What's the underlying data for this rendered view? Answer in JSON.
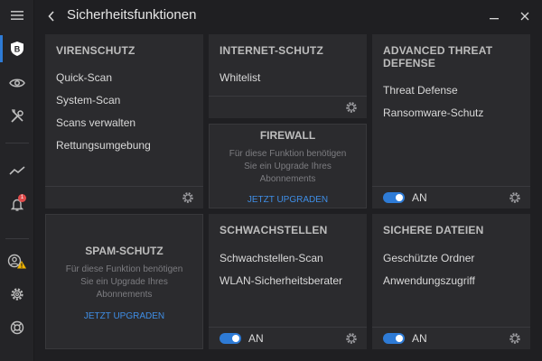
{
  "window": {
    "title": "Sicherheitsfunktionen"
  },
  "colors": {
    "accent": "#2e7bd6",
    "link": "#3f8ee6",
    "badge": "#e04b4b",
    "warning": "#f0b400"
  },
  "sidebar": {
    "items": [
      {
        "icon": "menu-icon"
      },
      {
        "icon": "bitdefender-shield-icon",
        "active": true,
        "glyph": "B"
      },
      {
        "icon": "eye-icon"
      },
      {
        "icon": "tools-icon"
      },
      {
        "icon": "activity-graph-icon"
      },
      {
        "icon": "bell-icon",
        "badge": "1"
      },
      {
        "icon": "account-warning-icon"
      },
      {
        "icon": "gear-icon"
      },
      {
        "icon": "lifebuoy-icon"
      }
    ]
  },
  "cards": {
    "virenschutz": {
      "title": "VIRENSCHUTZ",
      "items": [
        "Quick-Scan",
        "System-Scan",
        "Scans verwalten",
        "Rettungsumgebung"
      ]
    },
    "internet": {
      "title": "INTERNET-SCHUTZ",
      "items": [
        "Whitelist"
      ]
    },
    "atd": {
      "title_line1": "ADVANCED THREAT",
      "title_line2": "DEFENSE",
      "items": [
        "Threat Defense",
        "Ransomware-Schutz"
      ],
      "toggle_label": "AN"
    },
    "firewall": {
      "title": "FIREWALL",
      "msg_line1": "Für diese Funktion benötigen",
      "msg_line2": "Sie ein Upgrade Ihres",
      "msg_line3": "Abonnements",
      "link": "JETZT UPGRADEN"
    },
    "spam": {
      "title": "SPAM-SCHUTZ",
      "msg_line1": "Für diese Funktion benötigen",
      "msg_line2": "Sie ein Upgrade Ihres",
      "msg_line3": "Abonnements",
      "link": "JETZT UPGRADEN"
    },
    "schwachstellen": {
      "title": "SCHWACHSTELLEN",
      "items": [
        "Schwachstellen-Scan",
        "WLAN-Sicherheitsberater"
      ],
      "toggle_label": "AN"
    },
    "dateien": {
      "title": "SICHERE DATEIEN",
      "items": [
        "Geschützte Ordner",
        "Anwendungszugriff"
      ],
      "toggle_label": "AN"
    }
  }
}
